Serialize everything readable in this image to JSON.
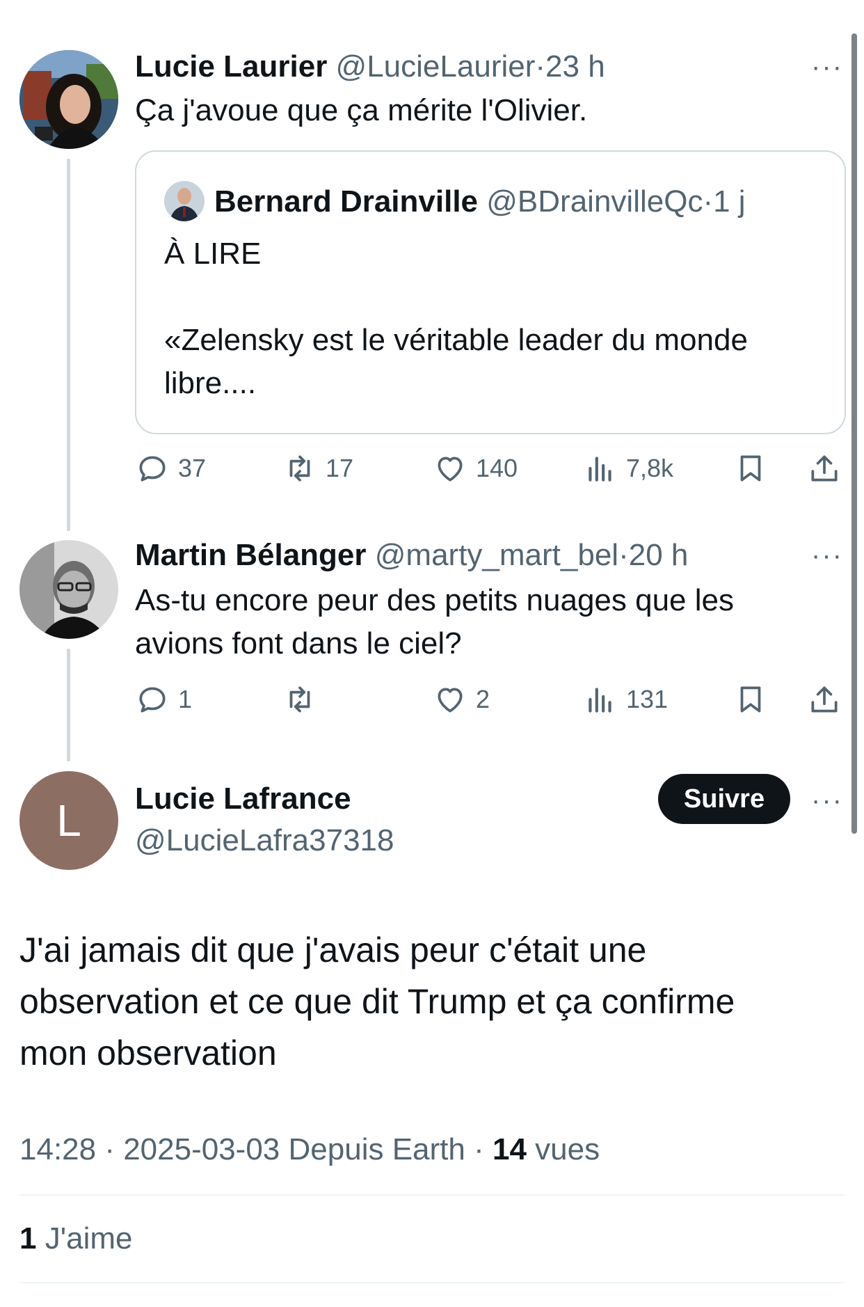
{
  "thread": [
    {
      "display_name": "Lucie Laurier",
      "handle": "@LucieLaurier",
      "time": "23 h",
      "text": "Ça j'avoue que ça mérite l'Olivier.",
      "quote": {
        "display_name": "Bernard Drainville",
        "handle": "@BDrainvilleQc",
        "time": "1 j",
        "line1": "À LIRE",
        "line2": "«Zelensky est le véritable leader du monde",
        "line3": "libre...."
      },
      "replies": "37",
      "reposts": "17",
      "likes": "140",
      "views": "7,8k"
    },
    {
      "display_name": "Martin Bélanger",
      "handle": "@marty_mart_bel",
      "time": "20 h",
      "line1": "As-tu encore peur des petits nuages que les",
      "line2": "avions font dans le ciel?",
      "replies": "1",
      "reposts": "",
      "likes": "2",
      "views": "131"
    }
  ],
  "main_post": {
    "avatar_letter": "L",
    "display_name": "Lucie Lafrance",
    "handle": "@LucieLafra37318",
    "follow_label": "Suivre",
    "line1": "J'ai jamais dit que j'avais peur c'était une",
    "line2": "observation et ce que dit Trump et ça confirme",
    "line3": "mon observation",
    "timestamp": "14:28 · 2025-03-03 Depuis Earth ·",
    "views_count": "14",
    "views_label": "vues",
    "likes_count": "1",
    "likes_label": "J'aime"
  },
  "separator": "·",
  "more_glyph": "···",
  "icons": [
    "reply-icon",
    "repost-icon",
    "like-icon",
    "views-icon",
    "bookmark-icon",
    "share-icon"
  ],
  "colors": {
    "text": "#0f1419",
    "muted": "#536471",
    "border": "#cfd9de",
    "button": "#0f1419",
    "avatar_letter_bg": "#8d6e63"
  }
}
